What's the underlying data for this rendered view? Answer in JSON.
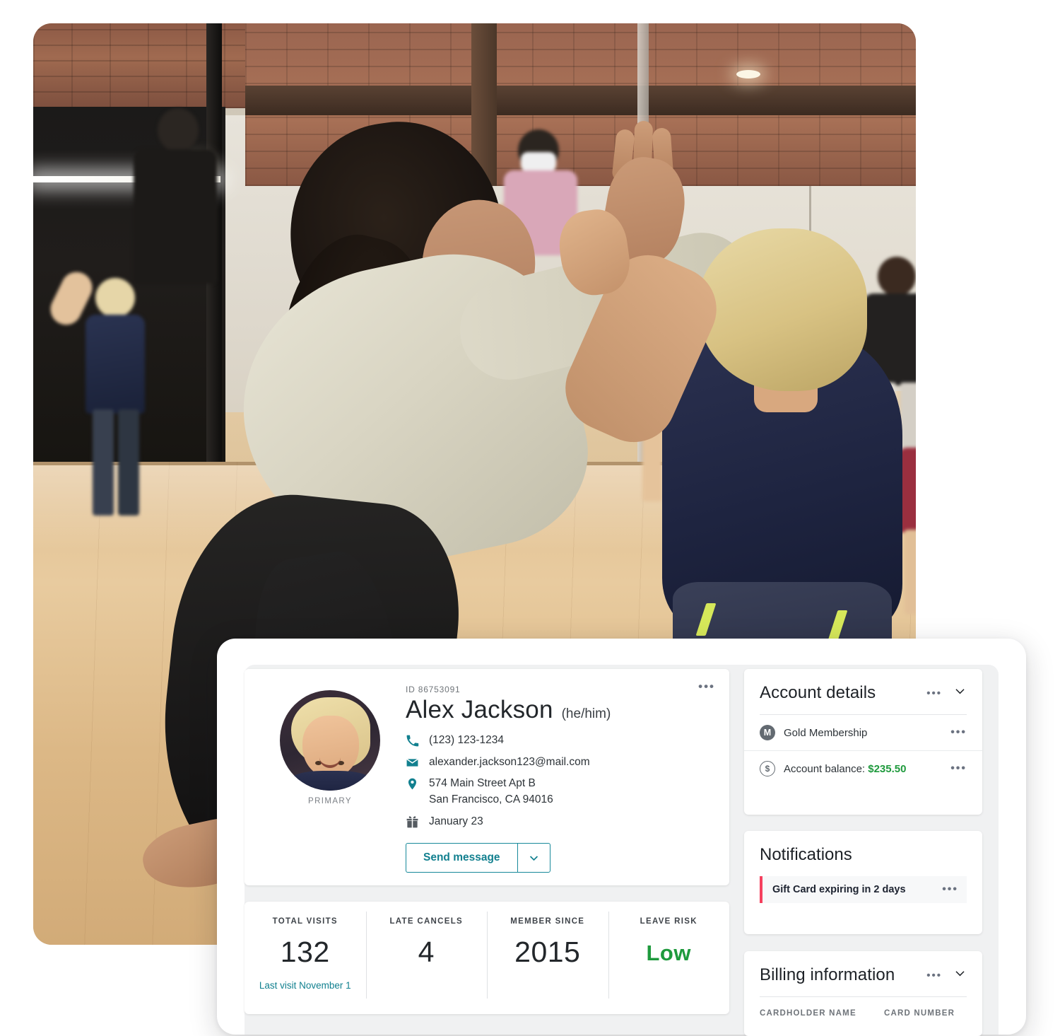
{
  "hero": {
    "alt": "dance instructor high-fiving a young child in a studio"
  },
  "profile": {
    "id_label": "ID 86753091",
    "name": "Alex Jackson",
    "pronouns": "(he/him)",
    "avatar_caption": "PRIMARY",
    "contacts": [
      {
        "icon": "phone-icon",
        "value": "(123) 123-1234"
      },
      {
        "icon": "email-icon",
        "value": "alexander.jackson123@mail.com"
      },
      {
        "icon": "location-pin-icon",
        "value": "574 Main Street Apt B",
        "value2": "San Francisco, CA 94016"
      },
      {
        "icon": "gift-icon",
        "value": "January 23"
      }
    ],
    "send_message_label": "Send message",
    "overflow_menu": "•••"
  },
  "stats": [
    {
      "label": "TOTAL VISITS",
      "value": "132",
      "sub": "Last visit November 1"
    },
    {
      "label": "LATE CANCELS",
      "value": "4",
      "sub": ""
    },
    {
      "label": "MEMBER SINCE",
      "value": "2015",
      "sub": ""
    },
    {
      "label": "LEAVE RISK",
      "value": "Low",
      "sub": ""
    }
  ],
  "account_details": {
    "title": "Account details",
    "overflow_menu": "•••",
    "rows": [
      {
        "badge": "M",
        "badge_style": "filled",
        "label": "Gold Membership",
        "amount": "",
        "overflow_menu": "•••"
      },
      {
        "badge": "$",
        "badge_style": "outline",
        "label": "Account balance: ",
        "amount": "$235.50",
        "overflow_menu": "•••"
      }
    ]
  },
  "notifications": {
    "title": "Notifications",
    "items": [
      {
        "text": "Gift Card expiring in 2 days",
        "overflow_menu": "•••"
      }
    ]
  },
  "billing": {
    "title": "Billing information",
    "overflow_menu": "•••",
    "columns": [
      {
        "label": "CARDHOLDER NAME"
      },
      {
        "label": "CARD NUMBER"
      }
    ]
  },
  "colors": {
    "teal": "#12808f",
    "green": "#1f9a3d",
    "red": "#f5405e",
    "text_dark": "#23272b",
    "text_muted": "#6f747a",
    "panel_bg": "#f0f1f2"
  }
}
